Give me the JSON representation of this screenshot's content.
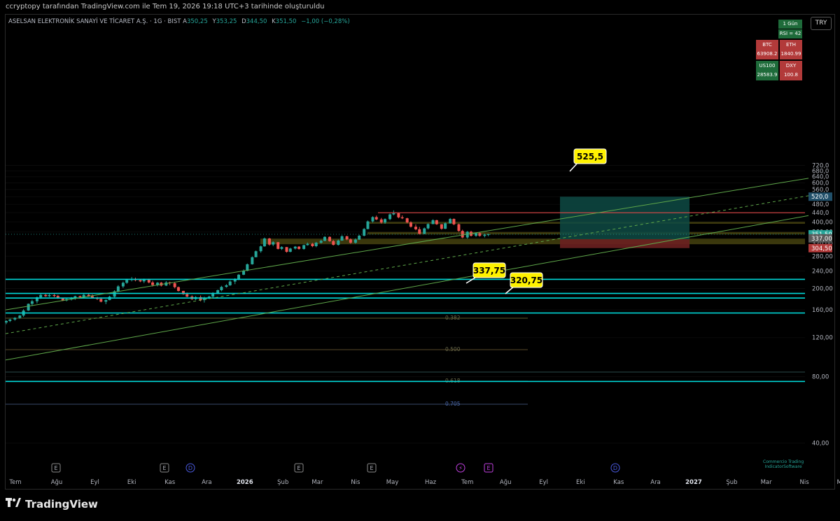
{
  "header": {
    "snapshot_note": "ccryptopy tarafından TradingView.com ile Tem 19, 2026 19:18 UTC+3 tarihinde oluşturuldu",
    "symbol": "ASELSAN ELEKTRONİK SANAYİ VE TİCARET A.Ş. · 1G · BIST",
    "ohlc": {
      "o_label": "A",
      "o": "350,25",
      "h_label": "Y",
      "h": "353,25",
      "l_label": "D",
      "l": "344,50",
      "c_label": "K",
      "c": "351,50",
      "change": "−1,00 (−0,28%)"
    },
    "currency": "TRY"
  },
  "chart_data": {
    "type": "candlestick",
    "y_axis": {
      "min": 40,
      "max": 760,
      "scale": "log",
      "ticks": [
        "720,0",
        "680,0",
        "640,0",
        "600,0",
        "560,0",
        "520,0",
        "480,0",
        "440,0",
        "400,00",
        "360,00",
        "320,00",
        "280,00",
        "240,00",
        "200,00",
        "160,00",
        "120,00",
        "80,00",
        "40,00"
      ]
    },
    "x_axis": {
      "ticks": [
        "Tem",
        "Ağu",
        "Eyl",
        "Eki",
        "Kas",
        "Ara",
        "2026",
        "Şub",
        "Mar",
        "Nis",
        "May",
        "Haz",
        "Tem",
        "Ağu",
        "Eyl",
        "Eki",
        "Kas",
        "Ara",
        "2027",
        "Şub",
        "Mar",
        "Nis",
        "Ma"
      ]
    },
    "price_tags": [
      {
        "value": "520,0",
        "color": "#21506a"
      },
      {
        "value": "351,50",
        "color": "#26a69a"
      },
      {
        "value": "337,00",
        "color": "#5a5a5a"
      },
      {
        "value": "304,50",
        "color": "#b23a3a"
      }
    ],
    "callouts": [
      {
        "label": "525,5",
        "value": 525.5
      },
      {
        "label": "337,75",
        "value": 337.75
      },
      {
        "label": "320,75",
        "value": 320.75
      }
    ],
    "fib_labels": [
      "0.382",
      "0.500",
      "0.618",
      "0.705"
    ],
    "horizontal_lines": [
      {
        "value": 440,
        "color": "#e04848"
      },
      {
        "value": 220,
        "color": "#00d8d8"
      },
      {
        "value": 190,
        "color": "#00d8d8"
      },
      {
        "value": 181,
        "color": "#00d8d8"
      },
      {
        "value": 155,
        "color": "#00d8d8"
      },
      {
        "value": 76,
        "color": "#00d8d8"
      }
    ],
    "zones": [
      {
        "from": 392,
        "to": 400,
        "color": "#807a1a"
      },
      {
        "from": 351,
        "to": 360,
        "color": "#807a1a"
      },
      {
        "from": 317,
        "to": 336,
        "color": "#807a1a"
      }
    ],
    "position_tool": {
      "target": 520,
      "entry": 334,
      "stop": 304.5
    },
    "candles": [
      {
        "t": "2025-06-21",
        "o": 140.4,
        "h": 143.8,
        "l": 138.0,
        "c": 142.6
      },
      {
        "t": "2025-06-24",
        "o": 142.6,
        "h": 146.0,
        "l": 141.0,
        "c": 144.8
      },
      {
        "t": "2025-06-28",
        "o": 144.8,
        "h": 148.5,
        "l": 143.0,
        "c": 147.3
      },
      {
        "t": "2025-07-02",
        "o": 147.3,
        "h": 151.8,
        "l": 146.0,
        "c": 150.9
      },
      {
        "t": "2025-07-05",
        "o": 150.9,
        "h": 161.1,
        "l": 148.8,
        "c": 159.0
      },
      {
        "t": "2025-07-09",
        "o": 159.0,
        "h": 171.1,
        "l": 158.3,
        "c": 170.5
      },
      {
        "t": "2025-07-12",
        "o": 170.5,
        "h": 178.0,
        "l": 166.6,
        "c": 175.1
      },
      {
        "t": "2025-07-16",
        "o": 175.1,
        "h": 183.9,
        "l": 171.1,
        "c": 182.4
      },
      {
        "t": "2025-07-19",
        "o": 182.4,
        "h": 189.7,
        "l": 179.4,
        "c": 187.0
      },
      {
        "t": "2025-07-23",
        "o": 187.0,
        "h": 188.7,
        "l": 183.3,
        "c": 184.6
      },
      {
        "t": "2025-07-26",
        "o": 184.6,
        "h": 189.9,
        "l": 182.8,
        "c": 186.7
      },
      {
        "t": "2025-07-30",
        "o": 186.7,
        "h": 188.7,
        "l": 182.8,
        "c": 185.0
      },
      {
        "t": "2025-08-02",
        "o": 185.0,
        "h": 187.2,
        "l": 179.6,
        "c": 181.2
      },
      {
        "t": "2025-08-06",
        "o": 181.2,
        "h": 181.4,
        "l": 175.5,
        "c": 176.6
      },
      {
        "t": "2025-08-09",
        "o": 176.6,
        "h": 181.0,
        "l": 175.0,
        "c": 179.2
      },
      {
        "t": "2025-08-13",
        "o": 179.2,
        "h": 183.0,
        "l": 176.6,
        "c": 179.8
      },
      {
        "t": "2025-08-16",
        "o": 179.8,
        "h": 185.5,
        "l": 177.9,
        "c": 184.5
      },
      {
        "t": "2025-08-20",
        "o": 184.5,
        "h": 185.8,
        "l": 180.2,
        "c": 182.4
      },
      {
        "t": "2025-08-23",
        "o": 182.4,
        "h": 189.2,
        "l": 181.3,
        "c": 187.2
      },
      {
        "t": "2025-08-27",
        "o": 187.2,
        "h": 189.7,
        "l": 183.4,
        "c": 184.6
      },
      {
        "t": "2025-08-30",
        "o": 184.6,
        "h": 188.0,
        "l": 180.1,
        "c": 181.2
      },
      {
        "t": "2025-09-03",
        "o": 181.2,
        "h": 183.4,
        "l": 177.5,
        "c": 179.4
      },
      {
        "t": "2025-09-06",
        "o": 179.4,
        "h": 182.3,
        "l": 173.2,
        "c": 174.3
      },
      {
        "t": "2025-09-10",
        "o": 174.3,
        "h": 178.5,
        "l": 169.9,
        "c": 177.3
      },
      {
        "t": "2025-09-13",
        "o": 177.3,
        "h": 185.5,
        "l": 176.9,
        "c": 183.6
      },
      {
        "t": "2025-09-17",
        "o": 183.6,
        "h": 196.5,
        "l": 182.3,
        "c": 194.2
      },
      {
        "t": "2025-09-20",
        "o": 194.2,
        "h": 207.0,
        "l": 192.6,
        "c": 204.4
      },
      {
        "t": "2025-09-24",
        "o": 204.4,
        "h": 214.9,
        "l": 201.0,
        "c": 212.2
      },
      {
        "t": "2025-09-27",
        "o": 212.2,
        "h": 221.1,
        "l": 209.9,
        "c": 218.6
      },
      {
        "t": "2025-10-01",
        "o": 218.6,
        "h": 225.2,
        "l": 215.4,
        "c": 220.2
      },
      {
        "t": "2025-10-04",
        "o": 220.2,
        "h": 224.0,
        "l": 215.5,
        "c": 218.1
      },
      {
        "t": "2025-10-08",
        "o": 218.1,
        "h": 220.3,
        "l": 213.6,
        "c": 215.4
      },
      {
        "t": "2025-10-11",
        "o": 215.4,
        "h": 221.6,
        "l": 211.6,
        "c": 219.8
      },
      {
        "t": "2025-10-15",
        "o": 219.8,
        "h": 221.2,
        "l": 210.9,
        "c": 212.9
      },
      {
        "t": "2025-10-18",
        "o": 212.9,
        "h": 216.5,
        "l": 204.2,
        "c": 207.3
      },
      {
        "t": "2025-10-22",
        "o": 207.3,
        "h": 213.8,
        "l": 204.4,
        "c": 212.4
      },
      {
        "t": "2025-10-25",
        "o": 212.4,
        "h": 214.1,
        "l": 204.2,
        "c": 206.1
      },
      {
        "t": "2025-10-29",
        "o": 206.1,
        "h": 215.9,
        "l": 205.1,
        "c": 213.0
      },
      {
        "t": "2025-11-01",
        "o": 213.0,
        "h": 214.7,
        "l": 207.0,
        "c": 211.2
      },
      {
        "t": "2025-11-05",
        "o": 211.2,
        "h": 214.5,
        "l": 200.2,
        "c": 202.8
      },
      {
        "t": "2025-11-08",
        "o": 202.8,
        "h": 204.1,
        "l": 193.8,
        "c": 195.0
      },
      {
        "t": "2025-11-12",
        "o": 195.0,
        "h": 195.3,
        "l": 187.3,
        "c": 188.5
      },
      {
        "t": "2025-11-15",
        "o": 188.5,
        "h": 191.7,
        "l": 182.6,
        "c": 183.8
      },
      {
        "t": "2025-11-19",
        "o": 183.8,
        "h": 186.2,
        "l": 177.4,
        "c": 179.1
      },
      {
        "t": "2025-11-22",
        "o": 179.1,
        "h": 184.6,
        "l": 177.3,
        "c": 182.8
      },
      {
        "t": "2025-11-26",
        "o": 182.8,
        "h": 185.9,
        "l": 174.9,
        "c": 177.3
      },
      {
        "t": "2025-11-29",
        "o": 177.3,
        "h": 183.6,
        "l": 172.8,
        "c": 180.5
      },
      {
        "t": "2025-12-03",
        "o": 180.5,
        "h": 185.6,
        "l": 179.0,
        "c": 183.8
      },
      {
        "t": "2025-12-06",
        "o": 183.8,
        "h": 192.4,
        "l": 181.6,
        "c": 189.2
      },
      {
        "t": "2025-12-10",
        "o": 189.2,
        "h": 197.8,
        "l": 188.9,
        "c": 196.5
      },
      {
        "t": "2025-12-13",
        "o": 196.5,
        "h": 205.6,
        "l": 194.2,
        "c": 203.3
      },
      {
        "t": "2025-12-17",
        "o": 203.3,
        "h": 209.2,
        "l": 201.8,
        "c": 206.8
      },
      {
        "t": "2025-12-20",
        "o": 206.8,
        "h": 217.7,
        "l": 205.4,
        "c": 215.0
      },
      {
        "t": "2025-12-24",
        "o": 215.0,
        "h": 222.4,
        "l": 209.3,
        "c": 220.7
      },
      {
        "t": "2025-12-27",
        "o": 220.7,
        "h": 232.5,
        "l": 218.0,
        "c": 230.8
      },
      {
        "t": "2025-12-31",
        "o": 230.8,
        "h": 243.8,
        "l": 229.7,
        "c": 240.6
      },
      {
        "t": "2026-01-03",
        "o": 240.6,
        "h": 259.4,
        "l": 239.4,
        "c": 257.3
      },
      {
        "t": "2026-01-07",
        "o": 257.3,
        "h": 279.2,
        "l": 256.3,
        "c": 276.9
      },
      {
        "t": "2026-01-10",
        "o": 276.9,
        "h": 296.7,
        "l": 276.9,
        "c": 294.8
      },
      {
        "t": "2026-01-14",
        "o": 294.8,
        "h": 313.0,
        "l": 290.2,
        "c": 310.1
      },
      {
        "t": "2026-01-17",
        "o": 310.1,
        "h": 339.8,
        "l": 308.9,
        "c": 336.6
      },
      {
        "t": "2026-01-21",
        "o": 336.6,
        "h": 338.5,
        "l": 312.3,
        "c": 315.9
      },
      {
        "t": "2026-01-24",
        "o": 315.9,
        "h": 327.1,
        "l": 310.7,
        "c": 323.8
      },
      {
        "t": "2026-01-28",
        "o": 323.8,
        "h": 324.2,
        "l": 300.3,
        "c": 302.0
      },
      {
        "t": "2026-01-31",
        "o": 302.0,
        "h": 310.4,
        "l": 298.6,
        "c": 307.7
      },
      {
        "t": "2026-02-04",
        "o": 307.7,
        "h": 308.0,
        "l": 290.5,
        "c": 292.9
      },
      {
        "t": "2026-02-07",
        "o": 292.9,
        "h": 305.5,
        "l": 291.6,
        "c": 303.1
      },
      {
        "t": "2026-02-11",
        "o": 303.1,
        "h": 311.1,
        "l": 300.2,
        "c": 309.1
      },
      {
        "t": "2026-02-14",
        "o": 309.1,
        "h": 310.9,
        "l": 299.4,
        "c": 301.8
      },
      {
        "t": "2026-02-18",
        "o": 301.8,
        "h": 315.9,
        "l": 299.4,
        "c": 314.1
      },
      {
        "t": "2026-02-21",
        "o": 314.1,
        "h": 322.5,
        "l": 312.5,
        "c": 318.4
      },
      {
        "t": "2026-02-25",
        "o": 318.4,
        "h": 321.5,
        "l": 307.5,
        "c": 310.7
      },
      {
        "t": "2026-02-28",
        "o": 310.7,
        "h": 324.7,
        "l": 307.3,
        "c": 322.1
      },
      {
        "t": "2026-03-04",
        "o": 322.1,
        "h": 331.9,
        "l": 318.9,
        "c": 328.3
      },
      {
        "t": "2026-03-07",
        "o": 328.3,
        "h": 344.5,
        "l": 327.2,
        "c": 342.1
      },
      {
        "t": "2026-03-11",
        "o": 342.1,
        "h": 344.1,
        "l": 325.0,
        "c": 327.5
      },
      {
        "t": "2026-03-14",
        "o": 327.5,
        "h": 331.2,
        "l": 313.1,
        "c": 314.9
      },
      {
        "t": "2026-03-18",
        "o": 314.9,
        "h": 332.7,
        "l": 312.8,
        "c": 329.3
      },
      {
        "t": "2026-03-21",
        "o": 329.3,
        "h": 348.1,
        "l": 328.5,
        "c": 344.3
      },
      {
        "t": "2026-03-25",
        "o": 344.3,
        "h": 346.2,
        "l": 330.6,
        "c": 333.4
      },
      {
        "t": "2026-03-28",
        "o": 333.4,
        "h": 336.9,
        "l": 318.7,
        "c": 322.0
      },
      {
        "t": "2026-04-01",
        "o": 322.0,
        "h": 336.9,
        "l": 318.9,
        "c": 332.6
      },
      {
        "t": "2026-04-04",
        "o": 332.6,
        "h": 349.6,
        "l": 331.6,
        "c": 346.5
      },
      {
        "t": "2026-04-08",
        "o": 346.5,
        "h": 375.1,
        "l": 344.2,
        "c": 371.3
      },
      {
        "t": "2026-04-11",
        "o": 371.3,
        "h": 405.5,
        "l": 370.4,
        "c": 402.1
      },
      {
        "t": "2026-04-15",
        "o": 402.1,
        "h": 424.1,
        "l": 397.2,
        "c": 420.4
      },
      {
        "t": "2026-04-18",
        "o": 420.4,
        "h": 426.9,
        "l": 407.2,
        "c": 410.3
      },
      {
        "t": "2026-04-22",
        "o": 410.3,
        "h": 416.8,
        "l": 393.2,
        "c": 397.4
      },
      {
        "t": "2026-04-25",
        "o": 397.4,
        "h": 414.6,
        "l": 392.2,
        "c": 411.8
      },
      {
        "t": "2026-04-29",
        "o": 411.8,
        "h": 436.6,
        "l": 407.1,
        "c": 432.5
      },
      {
        "t": "2026-05-02",
        "o": 432.5,
        "h": 450.7,
        "l": 428.5,
        "c": 437.6
      },
      {
        "t": "2026-05-06",
        "o": 437.6,
        "h": 439.0,
        "l": 415.3,
        "c": 419.5
      },
      {
        "t": "2026-05-09",
        "o": 419.5,
        "h": 428.1,
        "l": 411.8,
        "c": 415.2
      },
      {
        "t": "2026-05-13",
        "o": 415.2,
        "h": 417.7,
        "l": 394.3,
        "c": 397.6
      },
      {
        "t": "2026-05-16",
        "o": 397.6,
        "h": 402.6,
        "l": 376.9,
        "c": 380.3
      },
      {
        "t": "2026-05-20",
        "o": 380.3,
        "h": 389.8,
        "l": 366.6,
        "c": 370.4
      },
      {
        "t": "2026-05-23",
        "o": 370.4,
        "h": 379.5,
        "l": 350.7,
        "c": 353.6
      },
      {
        "t": "2026-05-27",
        "o": 353.6,
        "h": 377.1,
        "l": 351.5,
        "c": 373.9
      },
      {
        "t": "2026-05-30",
        "o": 373.9,
        "h": 394.2,
        "l": 369.6,
        "c": 390.9
      },
      {
        "t": "2026-06-03",
        "o": 390.9,
        "h": 410.9,
        "l": 390.4,
        "c": 407.1
      },
      {
        "t": "2026-06-06",
        "o": 407.1,
        "h": 408.6,
        "l": 387.9,
        "c": 390.3
      },
      {
        "t": "2026-06-10",
        "o": 390.3,
        "h": 391.2,
        "l": 368.7,
        "c": 372.5
      },
      {
        "t": "2026-06-13",
        "o": 372.5,
        "h": 397.8,
        "l": 370.9,
        "c": 394.2
      },
      {
        "t": "2026-06-17",
        "o": 394.2,
        "h": 416.6,
        "l": 393.1,
        "c": 412.4
      },
      {
        "t": "2026-06-20",
        "o": 412.4,
        "h": 414.4,
        "l": 386.7,
        "c": 390.2
      },
      {
        "t": "2026-06-24",
        "o": 390.2,
        "h": 393.1,
        "l": 361.0,
        "c": 364.1
      },
      {
        "t": "2026-06-27",
        "o": 364.1,
        "h": 368.6,
        "l": 337.5,
        "c": 340.1
      },
      {
        "t": "2026-07-01",
        "o": 340.1,
        "h": 363.7,
        "l": 336.1,
        "c": 360.9
      },
      {
        "t": "2026-07-04",
        "o": 360.9,
        "h": 364.7,
        "l": 343.4,
        "c": 346.3
      },
      {
        "t": "2026-07-08",
        "o": 346.3,
        "h": 358.2,
        "l": 342.1,
        "c": 355.7
      },
      {
        "t": "2026-07-11",
        "o": 355.7,
        "h": 360.0,
        "l": 343.0,
        "c": 345.8
      },
      {
        "t": "2026-07-15",
        "o": 345.8,
        "h": 353.6,
        "l": 340.5,
        "c": 350.3
      },
      {
        "t": "2026-07-18",
        "o": 350.3,
        "h": 353.3,
        "l": 344.5,
        "c": 351.5
      }
    ]
  },
  "mini_table": {
    "interval": "1 Gün",
    "rsi": "RSI = 42",
    "cells": [
      {
        "label": "BTC",
        "value": "63908.2",
        "bg": "#b23a3a"
      },
      {
        "label": "ETH",
        "value": "1840.99",
        "bg": "#b23a3a"
      },
      {
        "label": "US100",
        "value": "28583.9",
        "bg": "#1e6b3a"
      },
      {
        "label": "DXY",
        "value": "100.8",
        "bg": "#b23a3a"
      }
    ]
  },
  "watermark": {
    "line1": "Commercio Trading",
    "line2": "IndicatorSoftware"
  },
  "event_markers": {
    "earnings": "E",
    "dividend": "D",
    "split": "⚡"
  },
  "footer": {
    "brand": "TradingView"
  },
  "colors": {
    "up": "#26a69a",
    "down": "#ef5350",
    "channel": "#5fa84a",
    "callout": "#fff200"
  }
}
